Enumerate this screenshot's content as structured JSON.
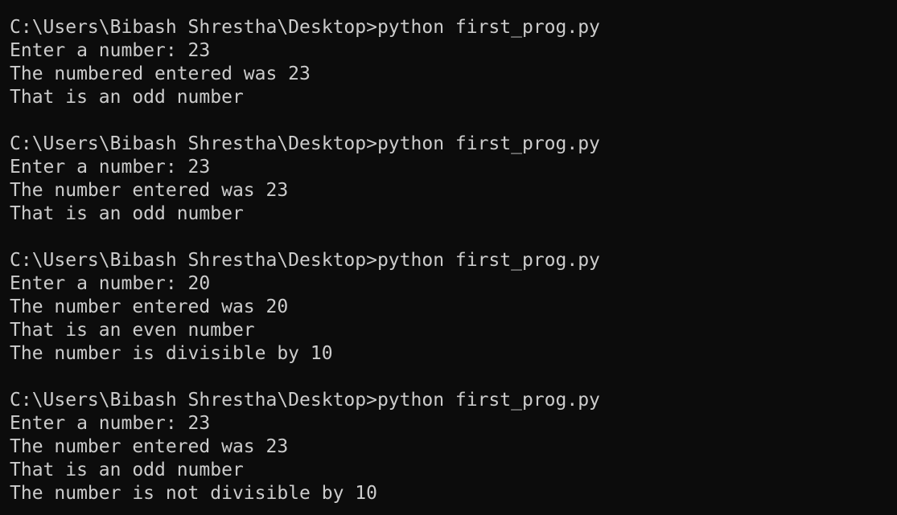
{
  "terminal": {
    "colors": {
      "background": "#0c0c0c",
      "foreground": "#cccccc"
    },
    "runs": [
      {
        "prompt": "C:\\Users\\Bibash Shrestha\\Desktop>python first_prog.py",
        "output": [
          "Enter a number: 23",
          "The numbered entered was 23",
          "That is an odd number"
        ]
      },
      {
        "prompt": "C:\\Users\\Bibash Shrestha\\Desktop>python first_prog.py",
        "output": [
          "Enter a number: 23",
          "The number entered was 23",
          "That is an odd number"
        ]
      },
      {
        "prompt": "C:\\Users\\Bibash Shrestha\\Desktop>python first_prog.py",
        "output": [
          "Enter a number: 20",
          "The number entered was 20",
          "That is an even number",
          "The number is divisible by 10"
        ]
      },
      {
        "prompt": "C:\\Users\\Bibash Shrestha\\Desktop>python first_prog.py",
        "output": [
          "Enter a number: 23",
          "The number entered was 23",
          "That is an odd number",
          "The number is not divisible by 10"
        ]
      }
    ]
  }
}
